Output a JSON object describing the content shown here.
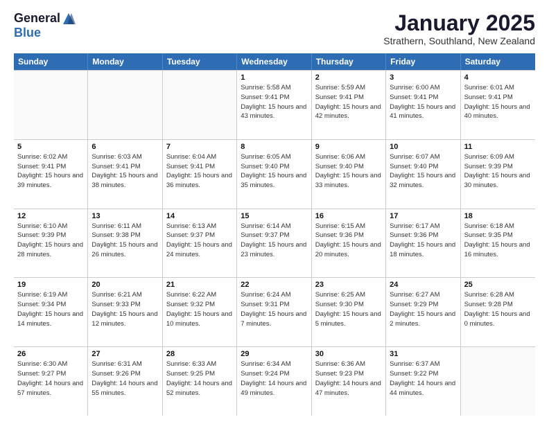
{
  "header": {
    "logo_general": "General",
    "logo_blue": "Blue",
    "month_title": "January 2025",
    "location": "Strathern, Southland, New Zealand"
  },
  "weekdays": [
    "Sunday",
    "Monday",
    "Tuesday",
    "Wednesday",
    "Thursday",
    "Friday",
    "Saturday"
  ],
  "weeks": [
    [
      {
        "day": "",
        "sunrise": "",
        "sunset": "",
        "daylight": ""
      },
      {
        "day": "",
        "sunrise": "",
        "sunset": "",
        "daylight": ""
      },
      {
        "day": "",
        "sunrise": "",
        "sunset": "",
        "daylight": ""
      },
      {
        "day": "1",
        "sunrise": "Sunrise: 5:58 AM",
        "sunset": "Sunset: 9:41 PM",
        "daylight": "Daylight: 15 hours and 43 minutes."
      },
      {
        "day": "2",
        "sunrise": "Sunrise: 5:59 AM",
        "sunset": "Sunset: 9:41 PM",
        "daylight": "Daylight: 15 hours and 42 minutes."
      },
      {
        "day": "3",
        "sunrise": "Sunrise: 6:00 AM",
        "sunset": "Sunset: 9:41 PM",
        "daylight": "Daylight: 15 hours and 41 minutes."
      },
      {
        "day": "4",
        "sunrise": "Sunrise: 6:01 AM",
        "sunset": "Sunset: 9:41 PM",
        "daylight": "Daylight: 15 hours and 40 minutes."
      }
    ],
    [
      {
        "day": "5",
        "sunrise": "Sunrise: 6:02 AM",
        "sunset": "Sunset: 9:41 PM",
        "daylight": "Daylight: 15 hours and 39 minutes."
      },
      {
        "day": "6",
        "sunrise": "Sunrise: 6:03 AM",
        "sunset": "Sunset: 9:41 PM",
        "daylight": "Daylight: 15 hours and 38 minutes."
      },
      {
        "day": "7",
        "sunrise": "Sunrise: 6:04 AM",
        "sunset": "Sunset: 9:41 PM",
        "daylight": "Daylight: 15 hours and 36 minutes."
      },
      {
        "day": "8",
        "sunrise": "Sunrise: 6:05 AM",
        "sunset": "Sunset: 9:40 PM",
        "daylight": "Daylight: 15 hours and 35 minutes."
      },
      {
        "day": "9",
        "sunrise": "Sunrise: 6:06 AM",
        "sunset": "Sunset: 9:40 PM",
        "daylight": "Daylight: 15 hours and 33 minutes."
      },
      {
        "day": "10",
        "sunrise": "Sunrise: 6:07 AM",
        "sunset": "Sunset: 9:40 PM",
        "daylight": "Daylight: 15 hours and 32 minutes."
      },
      {
        "day": "11",
        "sunrise": "Sunrise: 6:09 AM",
        "sunset": "Sunset: 9:39 PM",
        "daylight": "Daylight: 15 hours and 30 minutes."
      }
    ],
    [
      {
        "day": "12",
        "sunrise": "Sunrise: 6:10 AM",
        "sunset": "Sunset: 9:39 PM",
        "daylight": "Daylight: 15 hours and 28 minutes."
      },
      {
        "day": "13",
        "sunrise": "Sunrise: 6:11 AM",
        "sunset": "Sunset: 9:38 PM",
        "daylight": "Daylight: 15 hours and 26 minutes."
      },
      {
        "day": "14",
        "sunrise": "Sunrise: 6:13 AM",
        "sunset": "Sunset: 9:37 PM",
        "daylight": "Daylight: 15 hours and 24 minutes."
      },
      {
        "day": "15",
        "sunrise": "Sunrise: 6:14 AM",
        "sunset": "Sunset: 9:37 PM",
        "daylight": "Daylight: 15 hours and 23 minutes."
      },
      {
        "day": "16",
        "sunrise": "Sunrise: 6:15 AM",
        "sunset": "Sunset: 9:36 PM",
        "daylight": "Daylight: 15 hours and 20 minutes."
      },
      {
        "day": "17",
        "sunrise": "Sunrise: 6:17 AM",
        "sunset": "Sunset: 9:36 PM",
        "daylight": "Daylight: 15 hours and 18 minutes."
      },
      {
        "day": "18",
        "sunrise": "Sunrise: 6:18 AM",
        "sunset": "Sunset: 9:35 PM",
        "daylight": "Daylight: 15 hours and 16 minutes."
      }
    ],
    [
      {
        "day": "19",
        "sunrise": "Sunrise: 6:19 AM",
        "sunset": "Sunset: 9:34 PM",
        "daylight": "Daylight: 15 hours and 14 minutes."
      },
      {
        "day": "20",
        "sunrise": "Sunrise: 6:21 AM",
        "sunset": "Sunset: 9:33 PM",
        "daylight": "Daylight: 15 hours and 12 minutes."
      },
      {
        "day": "21",
        "sunrise": "Sunrise: 6:22 AM",
        "sunset": "Sunset: 9:32 PM",
        "daylight": "Daylight: 15 hours and 10 minutes."
      },
      {
        "day": "22",
        "sunrise": "Sunrise: 6:24 AM",
        "sunset": "Sunset: 9:31 PM",
        "daylight": "Daylight: 15 hours and 7 minutes."
      },
      {
        "day": "23",
        "sunrise": "Sunrise: 6:25 AM",
        "sunset": "Sunset: 9:30 PM",
        "daylight": "Daylight: 15 hours and 5 minutes."
      },
      {
        "day": "24",
        "sunrise": "Sunrise: 6:27 AM",
        "sunset": "Sunset: 9:29 PM",
        "daylight": "Daylight: 15 hours and 2 minutes."
      },
      {
        "day": "25",
        "sunrise": "Sunrise: 6:28 AM",
        "sunset": "Sunset: 9:28 PM",
        "daylight": "Daylight: 15 hours and 0 minutes."
      }
    ],
    [
      {
        "day": "26",
        "sunrise": "Sunrise: 6:30 AM",
        "sunset": "Sunset: 9:27 PM",
        "daylight": "Daylight: 14 hours and 57 minutes."
      },
      {
        "day": "27",
        "sunrise": "Sunrise: 6:31 AM",
        "sunset": "Sunset: 9:26 PM",
        "daylight": "Daylight: 14 hours and 55 minutes."
      },
      {
        "day": "28",
        "sunrise": "Sunrise: 6:33 AM",
        "sunset": "Sunset: 9:25 PM",
        "daylight": "Daylight: 14 hours and 52 minutes."
      },
      {
        "day": "29",
        "sunrise": "Sunrise: 6:34 AM",
        "sunset": "Sunset: 9:24 PM",
        "daylight": "Daylight: 14 hours and 49 minutes."
      },
      {
        "day": "30",
        "sunrise": "Sunrise: 6:36 AM",
        "sunset": "Sunset: 9:23 PM",
        "daylight": "Daylight: 14 hours and 47 minutes."
      },
      {
        "day": "31",
        "sunrise": "Sunrise: 6:37 AM",
        "sunset": "Sunset: 9:22 PM",
        "daylight": "Daylight: 14 hours and 44 minutes."
      },
      {
        "day": "",
        "sunrise": "",
        "sunset": "",
        "daylight": ""
      }
    ]
  ]
}
